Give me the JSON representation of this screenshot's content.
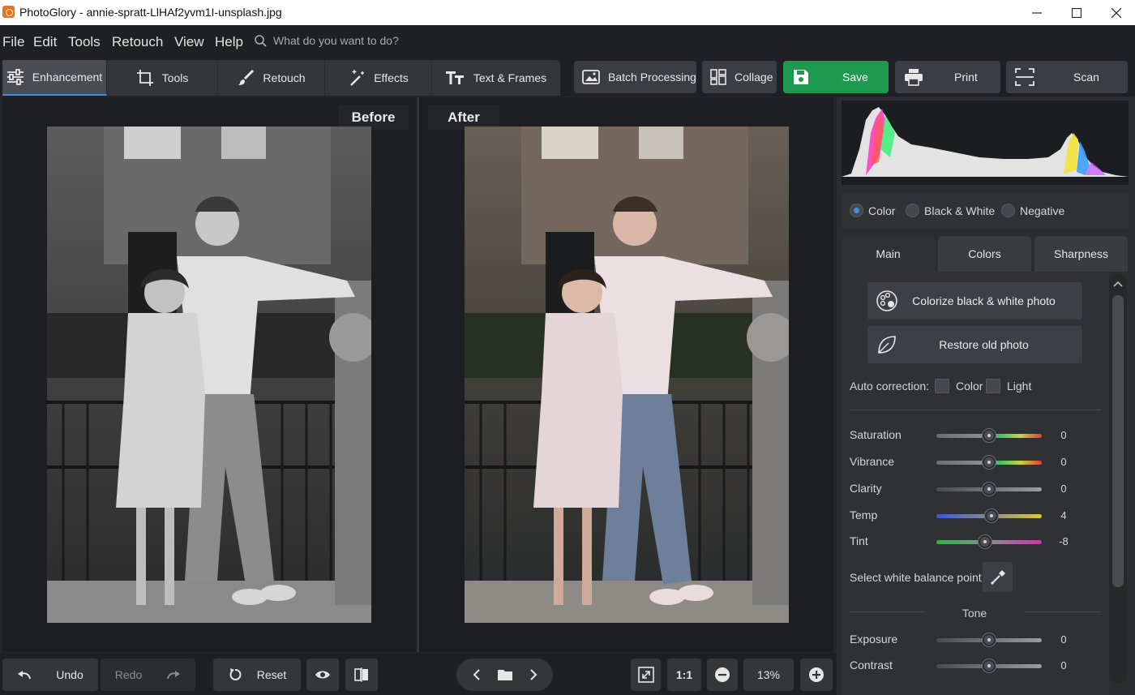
{
  "window": {
    "title": "PhotoGlory - annie-spratt-LlHAf2yvm1I-unsplash.jpg"
  },
  "menu": {
    "items": [
      "File",
      "Edit",
      "Tools",
      "Retouch",
      "View",
      "Help"
    ],
    "search_placeholder": "What do you want to do?"
  },
  "tabs": [
    {
      "label": "Enhancement",
      "icon": "sliders-icon",
      "active": true
    },
    {
      "label": "Tools",
      "icon": "crop-icon"
    },
    {
      "label": "Retouch",
      "icon": "brush-icon"
    },
    {
      "label": "Effects",
      "icon": "magic-wand-icon"
    },
    {
      "label": "Text & Frames",
      "icon": "text-icon"
    }
  ],
  "toolbar": {
    "batch": "Batch Processing",
    "collage": "Collage",
    "save": "Save",
    "print": "Print",
    "scan": "Scan"
  },
  "canvas": {
    "before_label": "Before",
    "after_label": "After"
  },
  "bottom": {
    "undo": "Undo",
    "redo": "Redo",
    "reset": "Reset",
    "actual_size": "1:1",
    "zoom": "13%"
  },
  "panel": {
    "modes": [
      {
        "label": "Color",
        "selected": true
      },
      {
        "label": "Black & White"
      },
      {
        "label": "Negative"
      }
    ],
    "tabs": [
      "Main",
      "Colors",
      "Sharpness"
    ],
    "colorize_button": "Colorize black & white photo",
    "restore_button": "Restore old photo",
    "auto_correction": {
      "label": "Auto correction:",
      "color": "Color",
      "light": "Light"
    },
    "sliders": [
      {
        "label": "Saturation",
        "value": "0",
        "level": 0.5
      },
      {
        "label": "Vibrance",
        "value": "0",
        "level": 0.5
      },
      {
        "label": "Clarity",
        "value": "0",
        "level": 0.5
      },
      {
        "label": "Temp",
        "value": "4",
        "level": 0.52
      },
      {
        "label": "Tint",
        "value": "-8",
        "level": 0.46
      }
    ],
    "white_balance": "Select white balance point",
    "tone": {
      "heading": "Tone",
      "sliders": [
        {
          "label": "Exposure",
          "value": "0",
          "level": 0.5
        },
        {
          "label": "Contrast",
          "value": "0",
          "level": 0.5
        }
      ]
    }
  },
  "colors": {
    "accent": "#3e8ed6",
    "save_green": "#1d9a4f",
    "app_bg": "#1e2023"
  }
}
